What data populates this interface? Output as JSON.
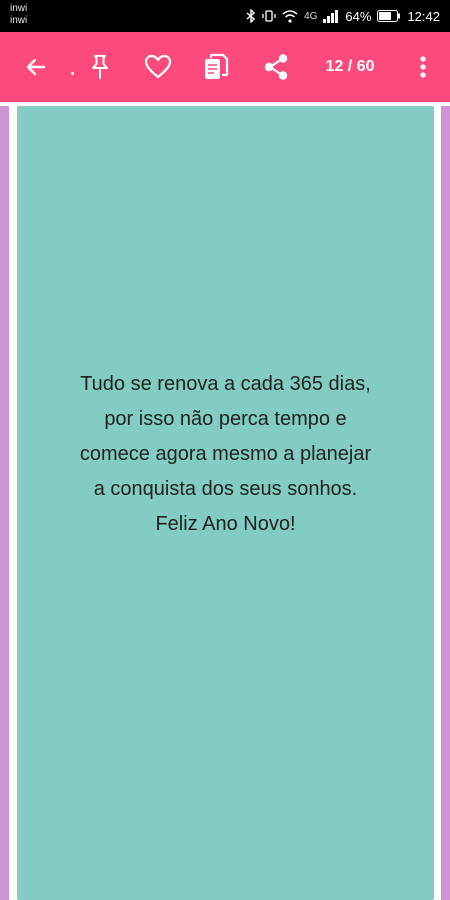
{
  "status_bar": {
    "carrier_line1": "inwi",
    "carrier_line2": "inwi",
    "network_label": "4G",
    "battery_percent": "64%",
    "time": "12:42",
    "icons": [
      "bluetooth-icon",
      "vibrate-icon",
      "wifi-icon",
      "signal-icon",
      "battery-icon"
    ]
  },
  "toolbar": {
    "background_color": "#fc4a7c",
    "icons": [
      "back-arrow-icon",
      "pin-icon",
      "heart-icon",
      "copy-icon",
      "share-icon",
      "more-vert-icon"
    ],
    "counter": "12 / 60"
  },
  "card": {
    "background_color": "#83ccc4",
    "side_card_color": "#cf94d6",
    "lines": [
      "Tudo se renova a cada 365 dias,",
      "por isso não perca tempo e",
      "comece agora mesmo a planejar",
      "a conquista dos seus sonhos.",
      "Feliz Ano Novo!"
    ]
  }
}
